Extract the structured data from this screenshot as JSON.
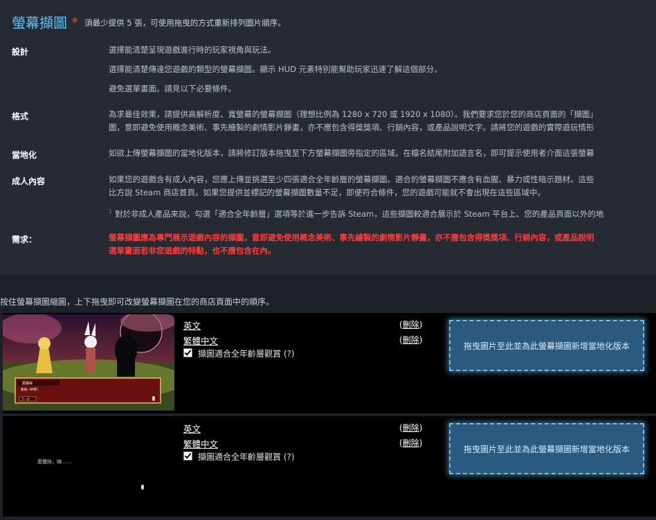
{
  "header": {
    "title": "螢幕擷圖",
    "required_mark": "*",
    "subtitle": "須最少提供 5 張，可使用拖曳的方式重新排列圖片順序。"
  },
  "requirements": {
    "design": {
      "label": "設計",
      "lines": [
        "選擇能清楚呈現遊戲進行時的玩家視角與玩法。",
        "選擇能清楚傳達您遊戲的類型的螢幕擷圖。顯示 HUD 元素特別能幫助玩家迅速了解這個部分。",
        "避免選單畫面。請見以下必要條件。"
      ]
    },
    "format": {
      "label": "格式",
      "lines": [
        "為求最佳效果，請提供高解析度、寬螢幕的螢幕擷圖（理想比例為 1280 x 720 或 1920 x 1080）。我們要求您於您的商店頁面的「擷圖」",
        "圖，意即避免使用概念美術、事先繪製的劇情影片靜畫，亦不應包含得獎獎項、行銷內容，或產品說明文字。請將您的遊戲的實際遊玩情形"
      ]
    },
    "localization": {
      "label": "當地化",
      "lines": [
        "如欲上傳螢幕擷圖的當地化版本，請將修訂版本拖曳至下方螢幕擷圖旁指定的區域。在檔名結尾附加語言名，即可提示使用者介面這張螢幕"
      ]
    },
    "adult": {
      "label": "成人內容",
      "lines": [
        "如果您的遊戲含有成人內容，您應上傳並挑選至少四張適合全年齡層的螢幕擷圖。適合的螢幕擷圖不應含有血腥、暴力或性暗示題材。這些",
        "比方說 Steam 商店首頁。如果您提供並標記的螢幕擷圖數量不足，即便符合條件，您的遊戲可能就不會出現在這些區域中。"
      ],
      "footnote_mark": "1",
      "footnote": "對於非成人產品來說，勾選「適合全年齡層」選項等於進一步告訴 Steam，這些擷圖較適合展示於 Steam 平台上、您的產品頁面以外的地"
    },
    "demand": {
      "label": "需求：",
      "lines": [
        "螢幕擷圖應為專門展示遊戲內容的擷圖，意即避免使用概念美術、事先繪製的劇情影片靜畫，亦不應包含得獎獎項、行銷內容，或產品說明",
        "選單畫面若非您遊戲的特點，也不應包含在內。"
      ]
    }
  },
  "instruction": "按住螢幕擷圖縮圖，上下拖曳即可改變螢幕擷圖在您的商店頁面中的順序。",
  "screenshots": [
    {
      "languages": [
        {
          "name": "英文",
          "delete_label": "刪除"
        },
        {
          "name": "繁體中文",
          "delete_label": "刪除"
        }
      ],
      "adult_checkbox_label": "擷圖適合全年齡層觀賞 (?)",
      "adult_checked": true,
      "dropzone_text": "拖曳圖片至此並為此螢幕擷圖新增當地化版本",
      "thumb_dialog_name": "愛麗絲",
      "thumb_dialog_line": "要來一杯嗎？",
      "thumb_dialog_button": "下一步"
    },
    {
      "languages": [
        {
          "name": "英文",
          "delete_label": "刪除"
        },
        {
          "name": "繁體中文",
          "delete_label": "刪除"
        }
      ],
      "adult_checkbox_label": "擷圖適合全年齡層觀賞 (?)",
      "adult_checked": true,
      "dropzone_text": "拖曳圖片至此並為此螢幕擷圖新增當地化版本",
      "thumb_caption": "愛麗絲，嗨……"
    }
  ],
  "colors": {
    "accent": "#67c1f5",
    "required": "#e04040",
    "warning_text": "#ff3b3b",
    "dropzone_bg": "#2a5a80"
  }
}
